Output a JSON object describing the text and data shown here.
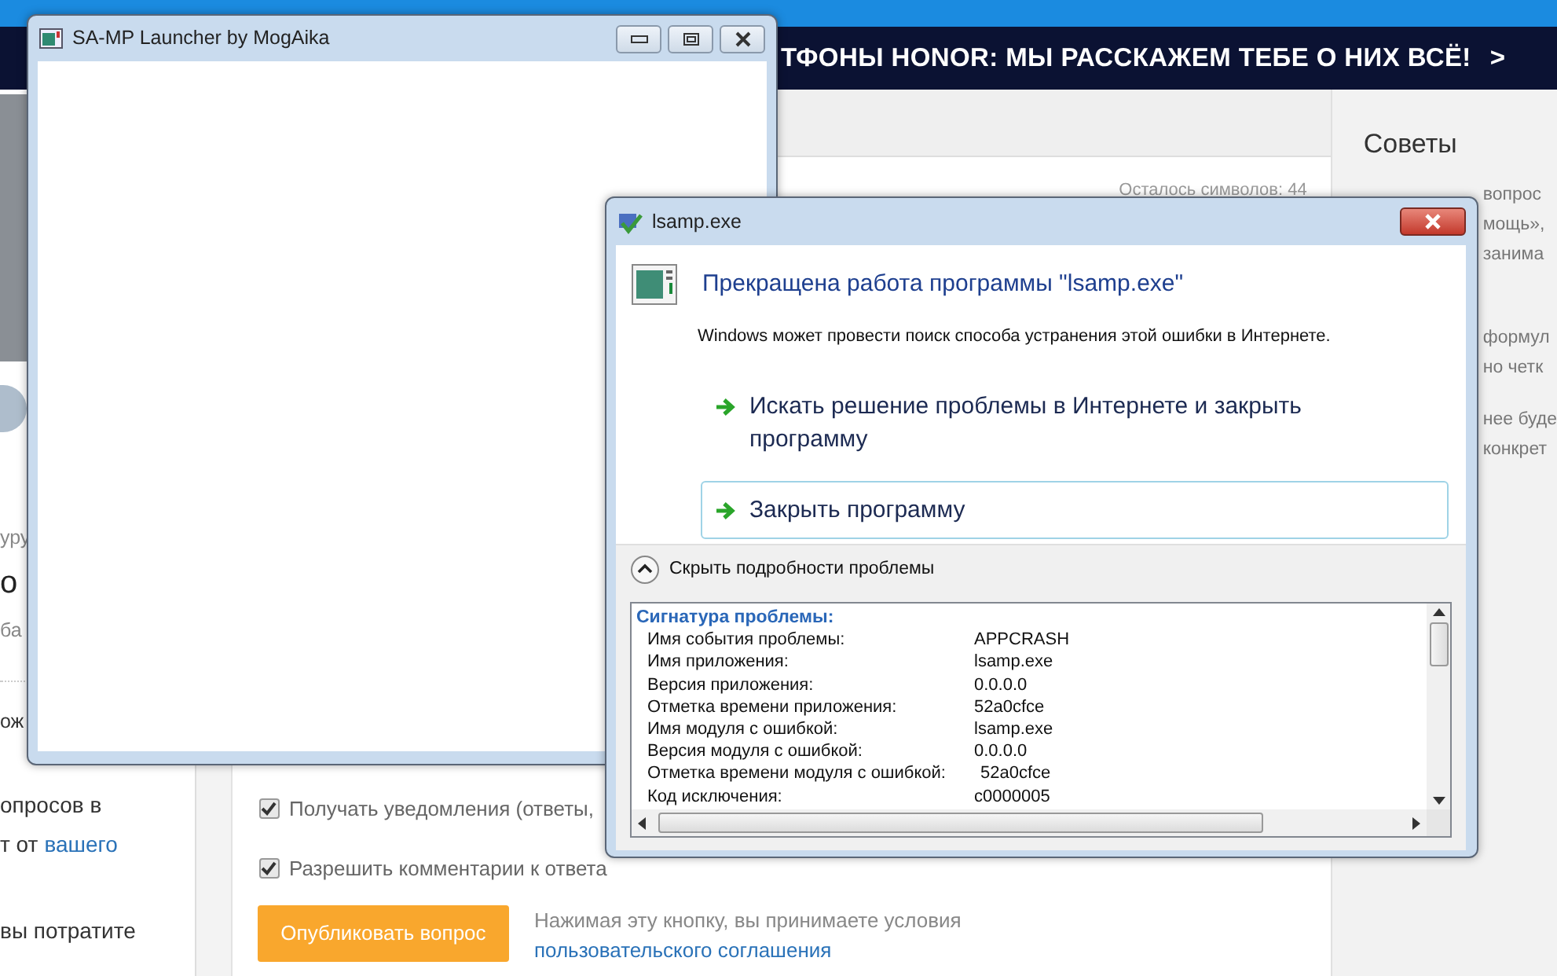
{
  "browser_page": {
    "banner": {
      "text": "ТФОНЫ HONOR: МЫ РАССКАЖЕМ ТЕБЕ О НИХ ВСЁ!",
      "arrow": ">"
    },
    "left_column": [
      {
        "kind": "muted",
        "text": "уру"
      },
      {
        "kind": "heading",
        "text": "о"
      },
      {
        "kind": "muted",
        "text": "ба"
      },
      {
        "kind": "plain",
        "text": "ож"
      },
      {
        "kind": "plain",
        "text": "опросов в"
      },
      {
        "kind": "link_line",
        "text": "т от",
        "link": "вашего"
      },
      {
        "kind": "plain",
        "text": "вы потратите"
      }
    ],
    "char_counter": "Осталось символов: 44",
    "options": [
      {
        "label": "Получать уведомления (ответы,",
        "checked": true
      },
      {
        "label": "Разрешить комментарии к ответа",
        "checked": true
      }
    ],
    "publish_button": "Опубликовать вопрос",
    "terms_text": "Нажимая эту кнопку, вы принимаете условия",
    "terms_link": "пользовательского соглашения",
    "tips": {
      "title": "Советы",
      "fragments": [
        "вопрос",
        "мощь»,",
        "занима",
        "формул",
        "но четк",
        "нее буде",
        "конкрет"
      ]
    }
  },
  "launcher_window": {
    "title": "SA-MP Launcher by MogAika"
  },
  "crash_dialog": {
    "title": "lsamp.exe",
    "heading": "Прекращена работа программы \"lsamp.exe\"",
    "message": "Windows может провести поиск способа устранения этой ошибки в Интернете.",
    "actions": [
      {
        "label": "Искать решение проблемы в Интернете и закрыть программу",
        "selected": false
      },
      {
        "label": "Закрыть программу",
        "selected": true
      }
    ],
    "details_toggle": "Скрыть подробности проблемы",
    "details_expanded": true,
    "details_heading": "Сигнатура проблемы:",
    "details": [
      {
        "name": "Имя события проблемы:",
        "value": "APPCRASH"
      },
      {
        "name": "Имя приложения:",
        "value": "lsamp.exe"
      },
      {
        "name": "Версия приложения:",
        "value": "0.0.0.0"
      },
      {
        "name": "Отметка времени приложения:",
        "value": "52a0cfce"
      },
      {
        "name": "Имя модуля с ошибкой:",
        "value": "lsamp.exe"
      },
      {
        "name": "Версия модуля с ошибкой:",
        "value": "0.0.0.0"
      },
      {
        "name": "Отметка времени модуля с ошибкой:",
        "value": "52a0cfce"
      },
      {
        "name": "Код исключения:",
        "value": "c0000005"
      }
    ]
  }
}
